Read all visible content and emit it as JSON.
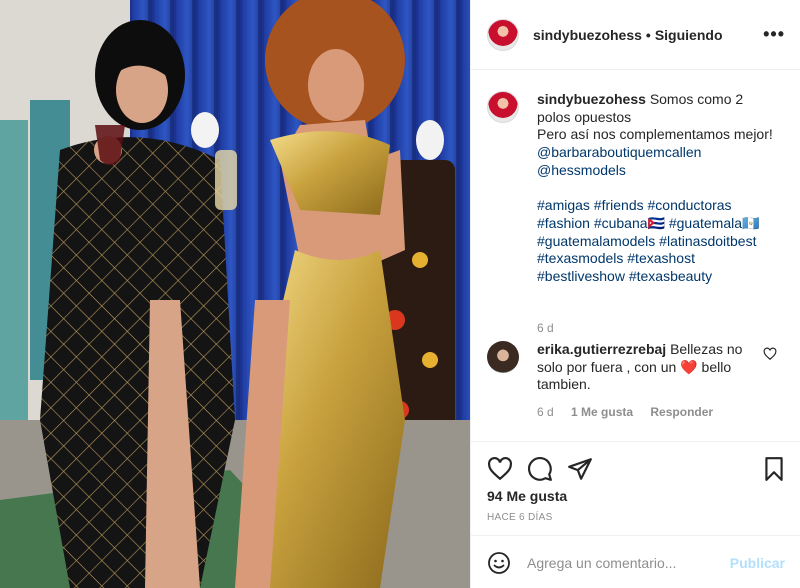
{
  "post": {
    "image_alt": "Dos mujeres posando en un set de televisión",
    "author": "sindybuezohess",
    "follow_status": "Siguiendo",
    "more_label": "•••"
  },
  "caption": {
    "author": "sindybuezohess",
    "lines": [
      "Somos como 2",
      "polos opuestos",
      "Pero así nos complementamos mejor!",
      "@barbaraboutiquemcallen",
      "@hessmodels",
      "",
      "#amigas #friends #conductoras",
      "#fashion #cubana🇨🇺 #guatemala🇬🇹",
      "#guatemalamodels #latinasdoitbest",
      "#texasmodels #texashost",
      "#bestliveshow #texasbeauty"
    ],
    "time": "6 d"
  },
  "reply": {
    "author": "erika.gutierrezrebaj",
    "text_before": "Bellezas no solo por fuera , con un",
    "emoji": "❤️",
    "text_after": "bello tambien.",
    "time": "6 d",
    "likes": "1 Me gusta",
    "reply_label": "Responder"
  },
  "actions": {
    "likes": "94 Me gusta",
    "posted_ago": "HACE 6 DÍAS"
  },
  "composer": {
    "placeholder": "Agrega un comentario...",
    "publish_label": "Publicar"
  },
  "colors": {
    "link": "#00376b",
    "muted": "#8e8e8e",
    "publish_disabled": "#b2dffc",
    "border": "#efefef"
  }
}
